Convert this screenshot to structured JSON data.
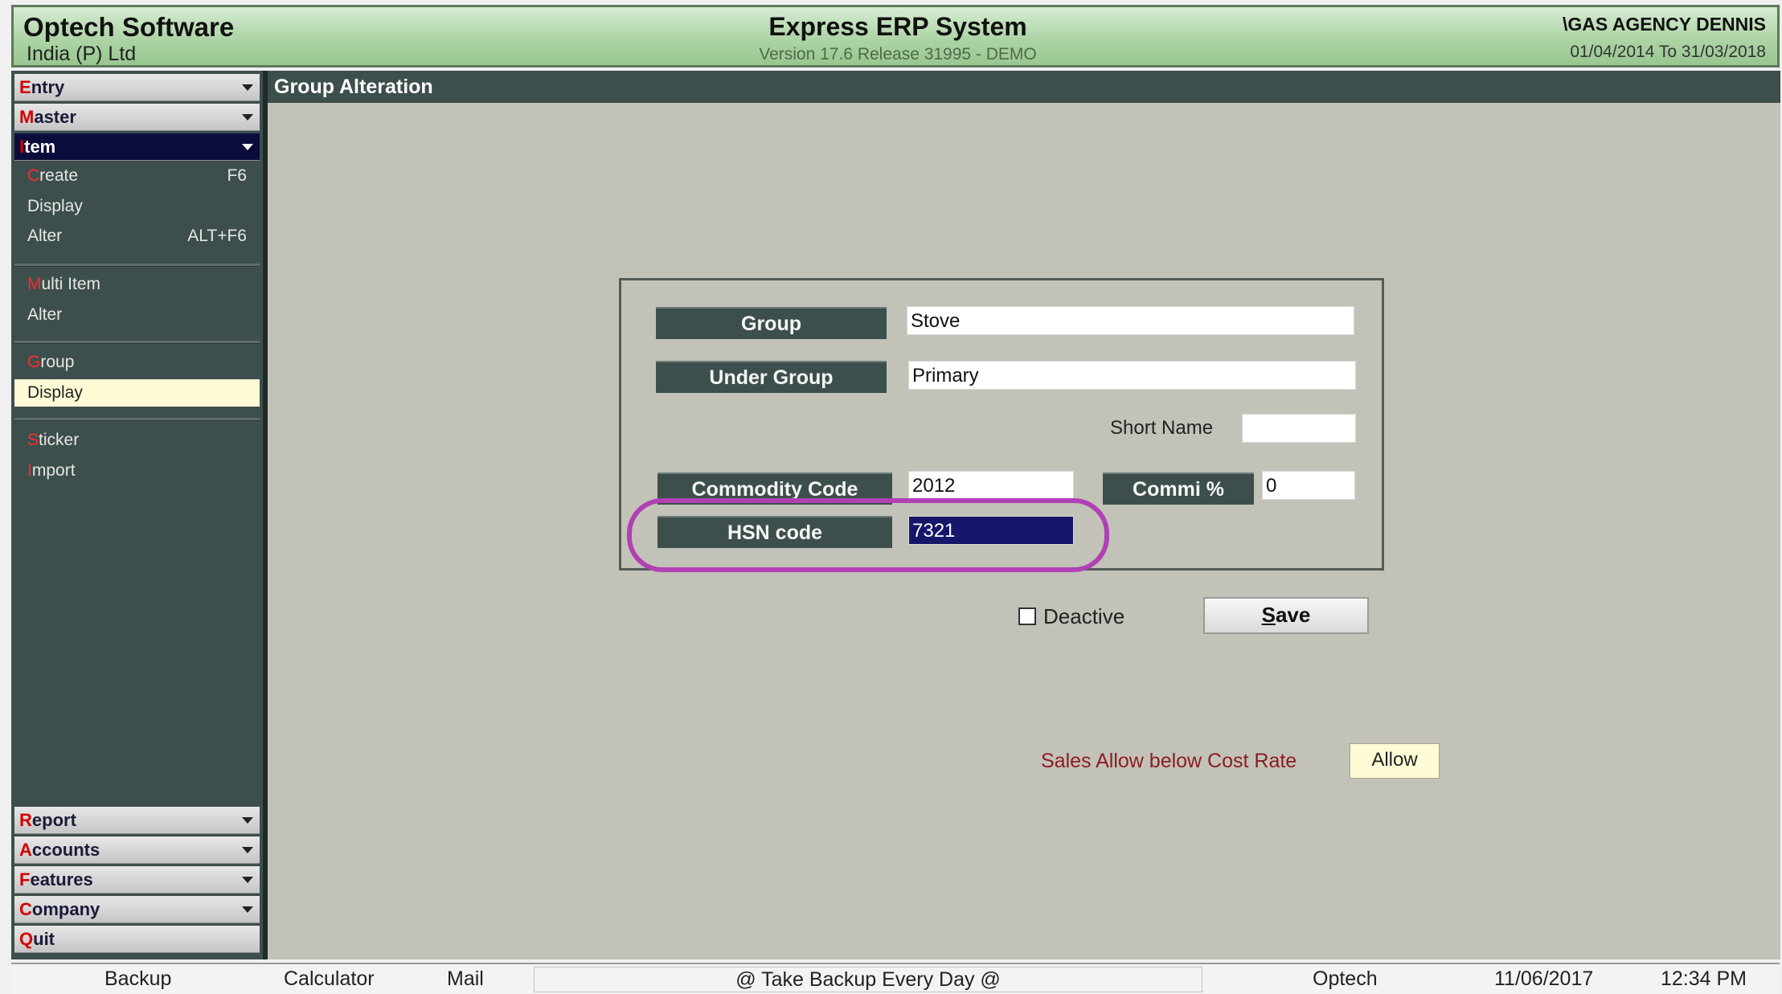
{
  "header": {
    "company": "Optech Software",
    "company_sub": "India (P) Ltd",
    "title": "Express ERP System",
    "version": "Version 17.6 Release 31995 - DEMO",
    "agency": "\\GAS AGENCY DENNIS",
    "period": "01/04/2014 To 31/03/2018"
  },
  "sidebar": {
    "menus_top": [
      {
        "first": "E",
        "rest": "ntry"
      },
      {
        "first": "M",
        "rest": "aster"
      },
      {
        "first": "I",
        "rest": "tem"
      }
    ],
    "item_submenu": {
      "create": {
        "first": "C",
        "rest": "reate",
        "shortcut": "F6"
      },
      "display": "Display",
      "alter": {
        "label": "Alter",
        "shortcut": "ALT+F6"
      },
      "multi_item": {
        "first": "M",
        "rest": "ulti Item"
      },
      "multi_alter": "Alter",
      "group": {
        "first": "G",
        "rest": "roup"
      },
      "group_display": "Display",
      "sticker": {
        "first": "S",
        "rest": "ticker"
      },
      "import": {
        "first": "I",
        "rest": "mport"
      }
    },
    "menus_bottom": [
      {
        "first": "R",
        "rest": "eport"
      },
      {
        "first": "A",
        "rest": "ccounts"
      },
      {
        "first": "F",
        "rest": "eatures"
      },
      {
        "first": "C",
        "rest": "ompany"
      },
      {
        "first": "Q",
        "rest": "uit"
      }
    ]
  },
  "panel": {
    "title": "Group Alteration"
  },
  "form": {
    "group_label": "Group",
    "group_value": "Stove",
    "under_group_label": "Under Group",
    "under_group_value": "Primary",
    "short_name_label": "Short Name",
    "short_name_value": "",
    "commodity_code_label": "Commodity Code",
    "commodity_code_value": "2012",
    "commi_label": "Commi %",
    "commi_value": "0",
    "hsn_label": "HSN code",
    "hsn_value": "7321",
    "deactive_label": "Deactive",
    "deactive_checked": false,
    "save_label_first": "S",
    "save_label_rest": "ave",
    "sales_label": "Sales Allow below Cost Rate",
    "allow_label": "Allow"
  },
  "statusbar": {
    "backup": "Backup",
    "calculator": "Calculator",
    "mail": "Mail",
    "message": "@ Take Backup Every Day @",
    "user": "Optech",
    "date": "11/06/2017",
    "time": "12:34 PM"
  },
  "colors": {
    "header_bg": "#aed4a6",
    "sidebar_bg": "#3d4f4d",
    "content_bg": "#c2c2b9",
    "accent_red": "#d40000",
    "highlight": "#b040b4",
    "selected_input": "#16166a"
  }
}
